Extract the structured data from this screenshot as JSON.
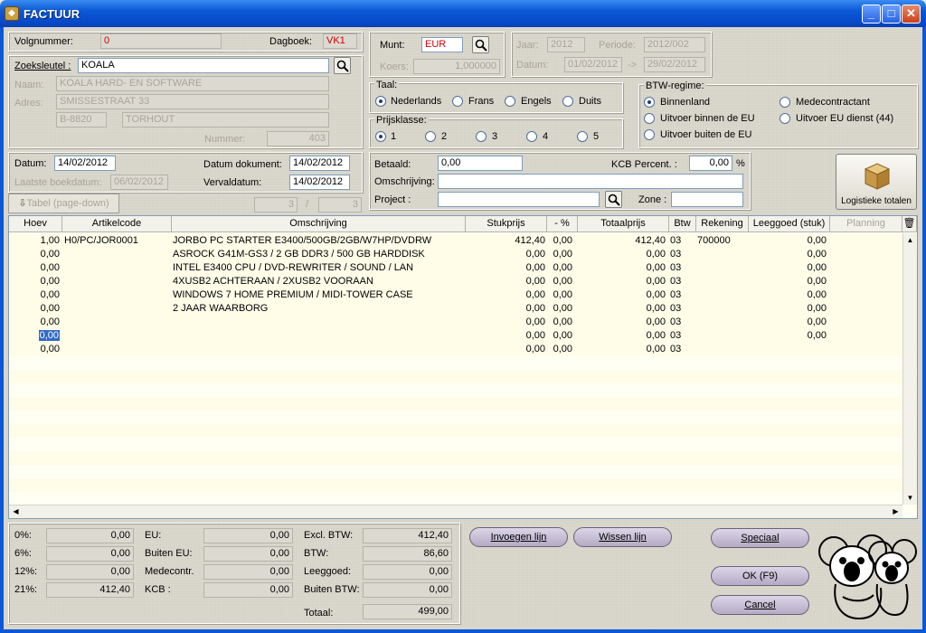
{
  "window": {
    "title": "FACTUUR"
  },
  "header": {
    "volgnummer_label": "Volgnummer:",
    "volgnummer": "0",
    "dagboek_label": "Dagboek:",
    "dagboek": "VK1",
    "munt_label": "Munt:",
    "munt": "EUR",
    "koers_label": "Koers:",
    "koers": "1,000000",
    "jaar_label": "Jaar:",
    "jaar": "2012",
    "periode_label": "Periode:",
    "periode": "2012/002",
    "datum_label": "Datum:",
    "datum_from": "01/02/2012",
    "datum_arrow": "->",
    "datum_to": "29/02/2012"
  },
  "customer": {
    "zoeksleutel_label": "Zoeksleutel :",
    "zoeksleutel": "KOALA",
    "naam_label": "Naam:",
    "naam": "KOALA HARD- EN SOFTWARE",
    "adres_label": "Adres:",
    "adres": "SMISSESTRAAT 33",
    "postcode": "B-8820",
    "gemeente": "TORHOUT",
    "nummer_label": "Nummer:",
    "nummer": "403"
  },
  "taal": {
    "label": "Taal:",
    "options": [
      "Nederlands",
      "Frans",
      "Engels",
      "Duits"
    ],
    "selected": "Nederlands"
  },
  "prijsklasse": {
    "label": "Prijsklasse:",
    "options": [
      "1",
      "2",
      "3",
      "4",
      "5"
    ],
    "selected": "1"
  },
  "btw_regime": {
    "label": "BTW-regime:",
    "options": [
      "Binnenland",
      "Uitvoer binnen de EU",
      "Uitvoer buiten de EU",
      "Medecontractant",
      "Uitvoer EU dienst (44)"
    ],
    "selected": "Binnenland"
  },
  "dates": {
    "datum_label": "Datum:",
    "datum": "14/02/2012",
    "datum_dokument_label": "Datum dokument:",
    "datum_dokument": "14/02/2012",
    "laatste_boekdatum_label": "Laatste boekdatum:",
    "laatste_boekdatum": "06/02/2012",
    "vervaldatum_label": "Vervaldatum:",
    "vervaldatum": "14/02/2012"
  },
  "payment": {
    "betaald_label": "Betaald:",
    "betaald": "0,00",
    "kcb_label": "KCB Percent. :",
    "kcb": "0,00",
    "kcb_unit": "%",
    "omschrijving_label": "Omschrijving:",
    "omschrijving": "",
    "project_label": "Project :",
    "project": "",
    "zone_label": "Zone :",
    "zone": ""
  },
  "logistics_button": {
    "label": "Logistieke totalen"
  },
  "tabel_button": {
    "label": "Tabel (page-down)",
    "page_current": "3",
    "page_sep": "/",
    "page_total": "3"
  },
  "grid": {
    "columns": [
      "Hoev",
      "Artikelcode",
      "Omschrijving",
      "Stukprijs",
      "- %",
      "Totaalprijs",
      "Btw",
      "Rekening",
      "Leeggoed (stuk)",
      "Planning"
    ],
    "rows": [
      [
        "1,00",
        "H0/PC/JOR0001",
        "JORBO PC STARTER E3400/500GB/2GB/W7HP/DVDRW",
        "412,40",
        "0,00",
        "412,40",
        "03",
        "700000",
        "0,00"
      ],
      [
        "0,00",
        "",
        "ASROCK G41M-GS3 / 2 GB DDR3 / 500 GB HARDDISK",
        "0,00",
        "0,00",
        "0,00",
        "03",
        "",
        "0,00"
      ],
      [
        "0,00",
        "",
        "INTEL E3400 CPU / DVD-REWRITER  / SOUND / LAN",
        "0,00",
        "0,00",
        "0,00",
        "03",
        "",
        "0,00"
      ],
      [
        "0,00",
        "",
        "4XUSB2 ACHTERAAN / 2XUSB2 VOORAAN",
        "0,00",
        "0,00",
        "0,00",
        "03",
        "",
        "0,00"
      ],
      [
        "0,00",
        "",
        "WINDOWS 7 HOME PREMIUM / MIDI-TOWER CASE",
        "0,00",
        "0,00",
        "0,00",
        "03",
        "",
        "0,00"
      ],
      [
        "0,00",
        "",
        "2 JAAR WAARBORG",
        "0,00",
        "0,00",
        "0,00",
        "03",
        "",
        "0,00"
      ],
      [
        "0,00",
        "",
        "",
        "0,00",
        "0,00",
        "0,00",
        "03",
        "",
        "0,00"
      ],
      [
        "0,00",
        "",
        "",
        "0,00",
        "0,00",
        "0,00",
        "03",
        "",
        "0,00"
      ],
      [
        "0,00",
        "",
        "",
        "0,00",
        "0,00",
        "0,00",
        "03",
        "",
        ""
      ]
    ]
  },
  "totals": {
    "rates": [
      {
        "label": "0%:",
        "value": "0,00"
      },
      {
        "label": "6%:",
        "value": "0,00"
      },
      {
        "label": "12%:",
        "value": "0,00"
      },
      {
        "label": "21%:",
        "value": "412,40"
      }
    ],
    "eu": [
      {
        "label": "EU:",
        "value": "0,00"
      },
      {
        "label": "Buiten EU:",
        "value": "0,00"
      },
      {
        "label": "Medecontr.",
        "value": "0,00"
      },
      {
        "label": "KCB :",
        "value": "0,00"
      }
    ],
    "summary": [
      {
        "label": "Excl. BTW:",
        "value": "412,40"
      },
      {
        "label": "BTW:",
        "value": "86,60"
      },
      {
        "label": "Leeggoed:",
        "value": "0,00"
      },
      {
        "label": "Buiten BTW:",
        "value": "0,00"
      }
    ],
    "totaal_label": "Totaal:",
    "totaal": "499,00"
  },
  "buttons": {
    "invoegen": "Invoegen lijn",
    "wissen": "Wissen lijn",
    "speciaal": "Speciaal",
    "ok": "OK (F9)",
    "cancel": "Cancel"
  }
}
